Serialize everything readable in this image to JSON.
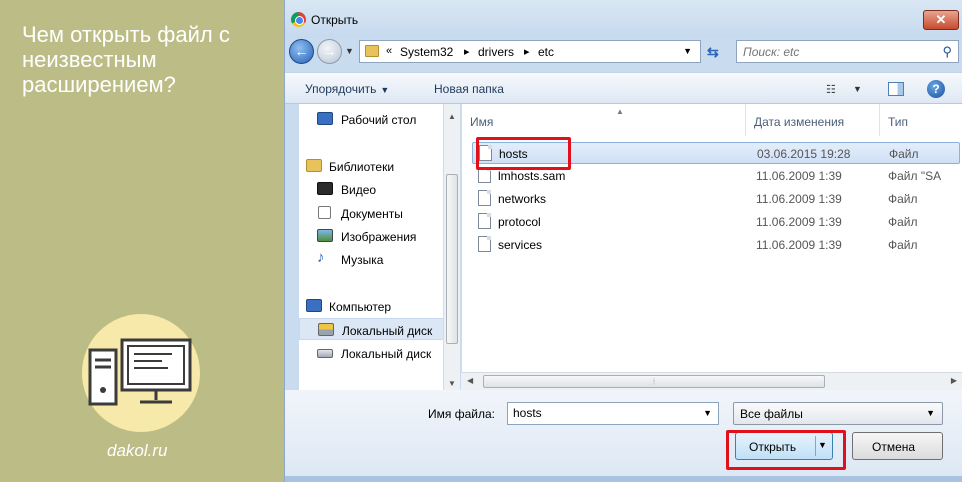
{
  "banner": {
    "title": "Чем открыть файл с неизвестным расширением?",
    "site": "dakol.ru",
    "circle_color": "#f7e9a9"
  },
  "dialog": {
    "title": "Открыть",
    "close_label": "✕",
    "address": {
      "prefix": "«",
      "parts": [
        "System32",
        "drivers",
        "etc"
      ]
    },
    "search_placeholder": "Поиск: etc",
    "toolbar": {
      "organize": "Упорядочить",
      "new_folder": "Новая папка"
    },
    "nav_items": [
      {
        "label": "Рабочий стол",
        "icon": "desktop-icon"
      },
      {
        "label": "Библиотеки",
        "icon": "libraries-icon"
      },
      {
        "label": "Видео",
        "icon": "video-icon"
      },
      {
        "label": "Документы",
        "icon": "documents-icon"
      },
      {
        "label": "Изображения",
        "icon": "images-icon"
      },
      {
        "label": "Музыка",
        "icon": "music-icon"
      },
      {
        "label": "Компьютер",
        "icon": "computer-icon"
      },
      {
        "label": "Локальный диск",
        "icon": "local-disk-icon"
      },
      {
        "label": "Локальный диск",
        "icon": "local-disk-icon"
      }
    ],
    "columns": {
      "name": "Имя",
      "date": "Дата изменения",
      "type": "Тип"
    },
    "files": [
      {
        "name": "hosts",
        "date": "03.06.2015 19:28",
        "type": "Файл"
      },
      {
        "name": "lmhosts.sam",
        "date": "11.06.2009 1:39",
        "type": "Файл \"SA"
      },
      {
        "name": "networks",
        "date": "11.06.2009 1:39",
        "type": "Файл"
      },
      {
        "name": "protocol",
        "date": "11.06.2009 1:39",
        "type": "Файл"
      },
      {
        "name": "services",
        "date": "11.06.2009 1:39",
        "type": "Файл"
      }
    ],
    "filename_label": "Имя файла:",
    "filename_value": "hosts",
    "filetype_value": "Все файлы",
    "open_label": "Открыть",
    "cancel_label": "Отмена",
    "highlight_color": "#e0111a",
    "accent_color": "#3c7fb1"
  }
}
